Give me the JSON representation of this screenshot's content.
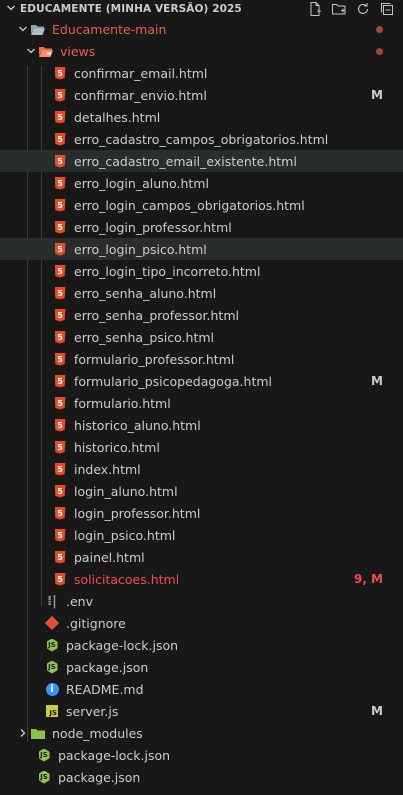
{
  "explorer": {
    "title": "EDUCAMENTE (MINHA VERSÃO) 2025",
    "actions": [
      "new-file-icon",
      "new-folder-icon",
      "refresh-icon",
      "collapse-all-icon"
    ]
  },
  "colors": {
    "html": "#e44d26",
    "modified": "#cccccc",
    "error": "#f14c4c",
    "folder_red": "#e8604c",
    "selected_row": "#2a2d2e"
  },
  "tree": {
    "root_folder": "Educamente-main",
    "views_folder": "views",
    "views_files": [
      {
        "label": "confirmar_email.html",
        "badge": ""
      },
      {
        "label": "confirmar_envio.html",
        "badge": "M"
      },
      {
        "label": "detalhes.html",
        "badge": ""
      },
      {
        "label": "erro_cadastro_campos_obrigatorios.html",
        "badge": ""
      },
      {
        "label": "erro_cadastro_email_existente.html",
        "badge": ""
      },
      {
        "label": "erro_login_aluno.html",
        "badge": ""
      },
      {
        "label": "erro_login_campos_obrigatorios.html",
        "badge": ""
      },
      {
        "label": "erro_login_professor.html",
        "badge": ""
      },
      {
        "label": "erro_login_psico.html",
        "badge": ""
      },
      {
        "label": "erro_login_tipo_incorreto.html",
        "badge": ""
      },
      {
        "label": "erro_senha_aluno.html",
        "badge": ""
      },
      {
        "label": "erro_senha_professor.html",
        "badge": ""
      },
      {
        "label": "erro_senha_psico.html",
        "badge": ""
      },
      {
        "label": "formulario_professor.html",
        "badge": ""
      },
      {
        "label": "formulario_psicopedagoga.html",
        "badge": "M"
      },
      {
        "label": "formulario.html",
        "badge": ""
      },
      {
        "label": "historico_aluno.html",
        "badge": ""
      },
      {
        "label": "historico.html",
        "badge": ""
      },
      {
        "label": "index.html",
        "badge": ""
      },
      {
        "label": "login_aluno.html",
        "badge": ""
      },
      {
        "label": "login_professor.html",
        "badge": ""
      },
      {
        "label": "login_psico.html",
        "badge": ""
      },
      {
        "label": "painel.html",
        "badge": ""
      },
      {
        "label": "solicitacoes.html",
        "badge": "9, M"
      }
    ],
    "main_files": [
      {
        "label": ".env",
        "icon": "env-icon",
        "badge": ""
      },
      {
        "label": ".gitignore",
        "icon": "git-icon",
        "badge": ""
      },
      {
        "label": "package-lock.json",
        "icon": "nodejs-icon",
        "badge": ""
      },
      {
        "label": "package.json",
        "icon": "nodejs-icon",
        "badge": ""
      },
      {
        "label": "README.md",
        "icon": "info-icon",
        "badge": ""
      },
      {
        "label": "server.js",
        "icon": "javascript-icon",
        "badge": "M"
      }
    ],
    "node_modules": "node_modules",
    "root_files": [
      {
        "label": "package-lock.json",
        "icon": "nodejs-icon"
      },
      {
        "label": "package.json",
        "icon": "nodejs-icon"
      }
    ]
  }
}
